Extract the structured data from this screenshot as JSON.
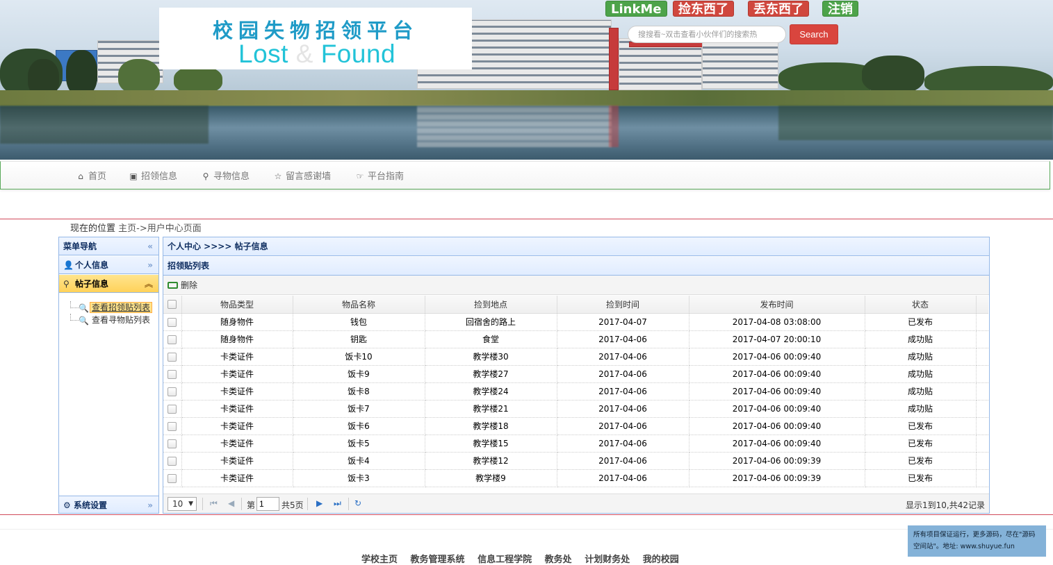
{
  "header": {
    "logo_cn": "校园失物招领平台",
    "logo_en_1": "Lost",
    "logo_en_amp": "&",
    "logo_en_2": "Found",
    "top_links": [
      "LinkMe",
      "捡东西了",
      "丢东西了",
      "注销"
    ],
    "search_placeholder": "搜搜看~双击查看小伙伴们的搜索热",
    "search_button": "Search"
  },
  "nav": [
    {
      "icon": "home-icon",
      "label": "首页"
    },
    {
      "icon": "image-icon",
      "label": "招领信息"
    },
    {
      "icon": "search-icon",
      "label": "寻物信息"
    },
    {
      "icon": "star-icon",
      "label": "留言感谢墙"
    },
    {
      "icon": "hand-point-icon",
      "label": "平台指南"
    }
  ],
  "breadcrumb": {
    "prefix": "现在的位置",
    "path": "主页->用户中心页面"
  },
  "sidebar": {
    "title": "菜单导航",
    "personal": "个人信息",
    "posts": "帖子信息",
    "tree": [
      "查看招领贴列表",
      "查看寻物贴列表"
    ],
    "system": "系统设置"
  },
  "panel": {
    "title": "个人中心 >>>> 帖子信息",
    "list_title": "招领贴列表",
    "delete_label": "删除"
  },
  "table": {
    "columns": [
      "物品类型",
      "物品名称",
      "捡到地点",
      "捡到时间",
      "发布时间",
      "状态"
    ],
    "rows": [
      [
        "随身物件",
        "钱包",
        "回宿舍的路上",
        "2017-04-07",
        "2017-04-08 03:08:00",
        "已发布"
      ],
      [
        "随身物件",
        "钥匙",
        "食堂",
        "2017-04-06",
        "2017-04-07 20:00:10",
        "成功贴"
      ],
      [
        "卡类证件",
        "饭卡10",
        "教学楼30",
        "2017-04-06",
        "2017-04-06 00:09:40",
        "成功贴"
      ],
      [
        "卡类证件",
        "饭卡9",
        "教学楼27",
        "2017-04-06",
        "2017-04-06 00:09:40",
        "成功贴"
      ],
      [
        "卡类证件",
        "饭卡8",
        "教学楼24",
        "2017-04-06",
        "2017-04-06 00:09:40",
        "成功贴"
      ],
      [
        "卡类证件",
        "饭卡7",
        "教学楼21",
        "2017-04-06",
        "2017-04-06 00:09:40",
        "成功贴"
      ],
      [
        "卡类证件",
        "饭卡6",
        "教学楼18",
        "2017-04-06",
        "2017-04-06 00:09:40",
        "已发布"
      ],
      [
        "卡类证件",
        "饭卡5",
        "教学楼15",
        "2017-04-06",
        "2017-04-06 00:09:40",
        "已发布"
      ],
      [
        "卡类证件",
        "饭卡4",
        "教学楼12",
        "2017-04-06",
        "2017-04-06 00:09:39",
        "已发布"
      ],
      [
        "卡类证件",
        "饭卡3",
        "教学楼9",
        "2017-04-06",
        "2017-04-06 00:09:39",
        "已发布"
      ]
    ]
  },
  "pager": {
    "page_size": "10",
    "page_prefix": "第",
    "current_page": "1",
    "total_pages": "共5页",
    "info": "显示1到10,共42记录"
  },
  "footer": {
    "links": [
      "学校主页",
      "教务管理系统",
      "信息工程学院",
      "教务处",
      "计划财务处",
      "我的校园"
    ],
    "ad_text": "所有项目保证运行，更多源码，尽在\"源码空间站\"。地址: www.shuyue.fun"
  },
  "colors": {
    "accent_blue": "#95b8e7",
    "highlight_yellow": "#ffe48d",
    "red_line": "#d14a5a",
    "search_red": "#d9453e"
  }
}
